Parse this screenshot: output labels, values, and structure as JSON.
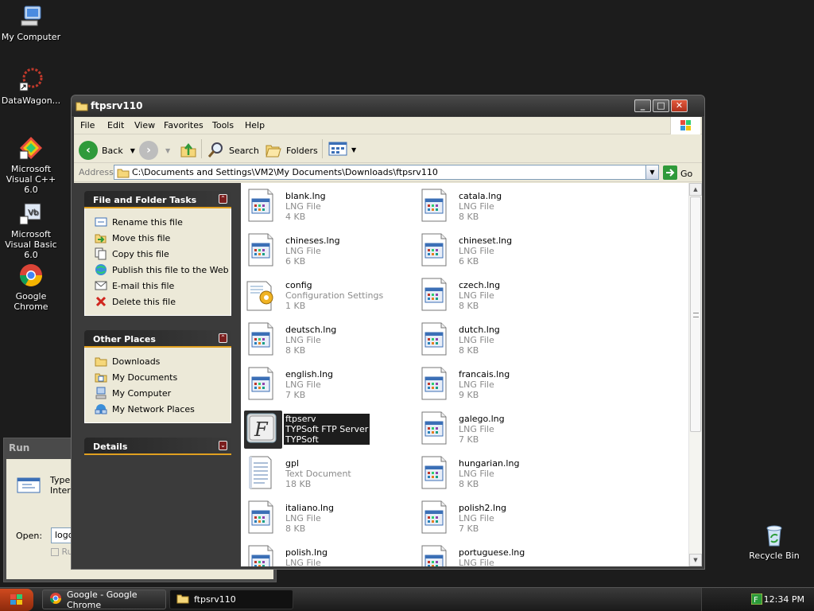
{
  "desktop": {
    "icons": [
      {
        "label": "My Computer",
        "icon": "my-computer-icon"
      },
      {
        "label": "DataWagon...",
        "icon": "datawagon-shortcut-icon"
      },
      {
        "label": "Microsoft Visual C++ 6.0",
        "icon": "visual-cpp-icon"
      },
      {
        "label": "Microsoft Visual Basic 6.0",
        "icon": "visual-basic-icon"
      },
      {
        "label": "Google Chrome",
        "icon": "chrome-icon"
      },
      {
        "label": "Recycle Bin",
        "icon": "recycle-bin-icon"
      }
    ]
  },
  "run_dialog": {
    "title": "Run",
    "type_text_line1": "Type t",
    "type_text_line2": "Intern",
    "open_label": "Open:",
    "open_value": "logof",
    "checkbox_label": "Ru"
  },
  "window": {
    "title": "ftpsrv110",
    "menu": [
      "File",
      "Edit",
      "View",
      "Favorites",
      "Tools",
      "Help"
    ],
    "toolbar": {
      "back": "Back",
      "search": "Search",
      "folders": "Folders"
    },
    "address": {
      "label": "Address",
      "value": "C:\\Documents and Settings\\VM2\\My Documents\\Downloads\\ftpsrv110",
      "go": "Go"
    },
    "file_tasks": {
      "title": "File and Folder Tasks",
      "items": [
        {
          "label": "Rename this file",
          "icon": "rename-icon"
        },
        {
          "label": "Move this file",
          "icon": "move-icon"
        },
        {
          "label": "Copy this file",
          "icon": "copy-icon"
        },
        {
          "label": "Publish this file to the Web",
          "icon": "publish-web-icon"
        },
        {
          "label": "E-mail this file",
          "icon": "email-icon"
        },
        {
          "label": "Delete this file",
          "icon": "delete-icon"
        }
      ]
    },
    "other_places": {
      "title": "Other Places",
      "items": [
        {
          "label": "Downloads",
          "icon": "folder-icon"
        },
        {
          "label": "My Documents",
          "icon": "my-documents-icon"
        },
        {
          "label": "My Computer",
          "icon": "my-computer-icon"
        },
        {
          "label": "My Network Places",
          "icon": "network-places-icon"
        }
      ]
    },
    "details": {
      "title": "Details"
    },
    "files": [
      {
        "name": "blank.lng",
        "type": "LNG File",
        "size": "4 KB",
        "icon": "lng-file-icon"
      },
      {
        "name": "catala.lng",
        "type": "LNG File",
        "size": "8 KB",
        "icon": "lng-file-icon"
      },
      {
        "name": "chineses.lng",
        "type": "LNG File",
        "size": "6 KB",
        "icon": "lng-file-icon"
      },
      {
        "name": "chineset.lng",
        "type": "LNG File",
        "size": "6 KB",
        "icon": "lng-file-icon"
      },
      {
        "name": "config",
        "type": "Configuration Settings",
        "size": "1 KB",
        "icon": "config-file-icon"
      },
      {
        "name": "czech.lng",
        "type": "LNG File",
        "size": "8 KB",
        "icon": "lng-file-icon"
      },
      {
        "name": "deutsch.lng",
        "type": "LNG File",
        "size": "8 KB",
        "icon": "lng-file-icon"
      },
      {
        "name": "dutch.lng",
        "type": "LNG File",
        "size": "8 KB",
        "icon": "lng-file-icon"
      },
      {
        "name": "english.lng",
        "type": "LNG File",
        "size": "7 KB",
        "icon": "lng-file-icon"
      },
      {
        "name": "francais.lng",
        "type": "LNG File",
        "size": "9 KB",
        "icon": "lng-file-icon"
      },
      {
        "name": "ftpserv",
        "type": "TYPSoft FTP Server",
        "size": "TYPSoft",
        "icon": "ftpserv-app-icon",
        "selected": true
      },
      {
        "name": "galego.lng",
        "type": "LNG File",
        "size": "7 KB",
        "icon": "lng-file-icon"
      },
      {
        "name": "gpl",
        "type": "Text Document",
        "size": "18 KB",
        "icon": "text-document-icon"
      },
      {
        "name": "hungarian.lng",
        "type": "LNG File",
        "size": "8 KB",
        "icon": "lng-file-icon"
      },
      {
        "name": "italiano.lng",
        "type": "LNG File",
        "size": "8 KB",
        "icon": "lng-file-icon"
      },
      {
        "name": "polish2.lng",
        "type": "LNG File",
        "size": "7 KB",
        "icon": "lng-file-icon"
      },
      {
        "name": "polish.lng",
        "type": "LNG File",
        "size": "",
        "icon": "lng-file-icon"
      },
      {
        "name": "portuguese.lng",
        "type": "LNG File",
        "size": "",
        "icon": "lng-file-icon"
      }
    ]
  },
  "taskbar": {
    "buttons": [
      {
        "label": "Google - Google Chrome",
        "icon": "chrome-icon"
      },
      {
        "label": "ftpsrv110",
        "icon": "folder-icon"
      }
    ],
    "clock": "12:34 PM"
  },
  "colors": {
    "desktop_bg": "#1c1c1c",
    "panel_accent": "#e0a020",
    "selection": "#1d1d1d"
  }
}
